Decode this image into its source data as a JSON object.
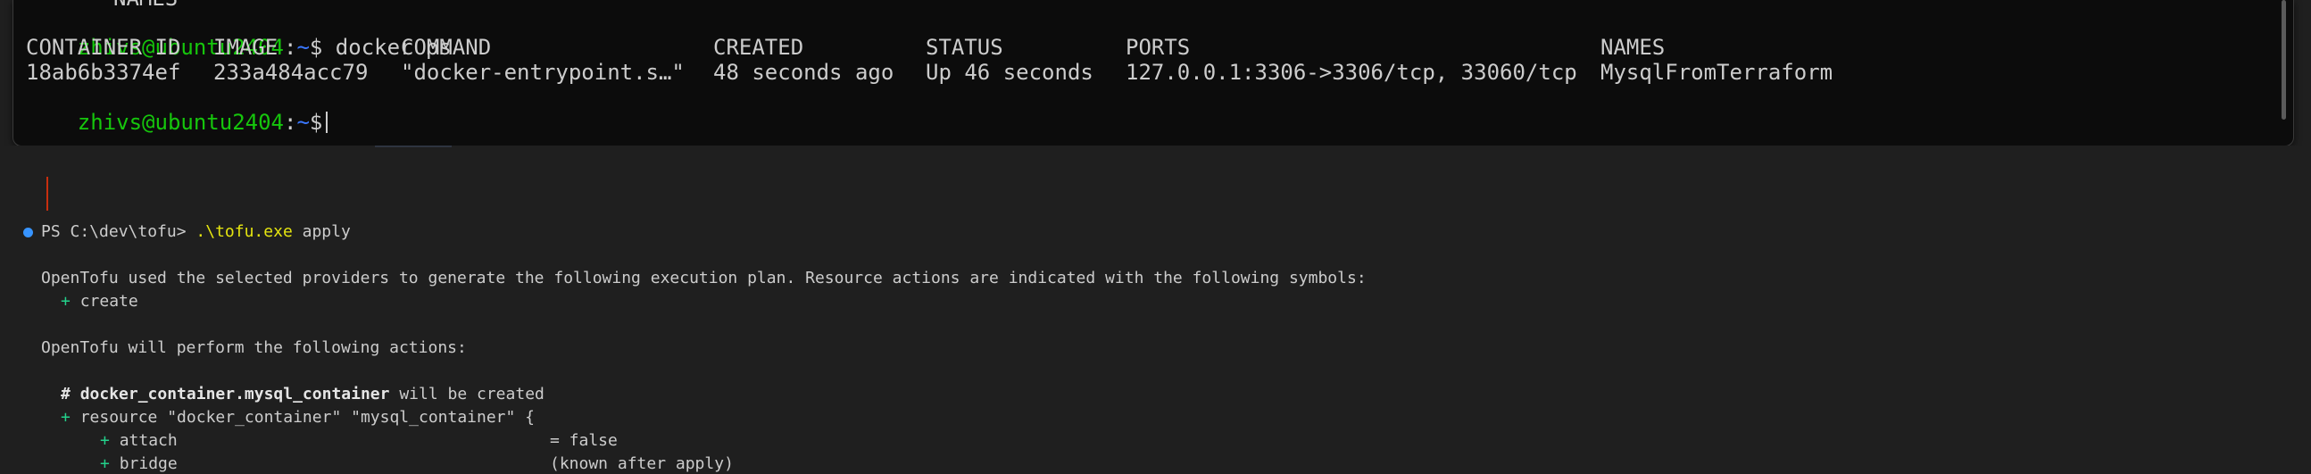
{
  "top_terminal": {
    "partial_line": "NAMES",
    "prompt_user_host": "zhivs@ubuntu2404",
    "prompt_colon": ":",
    "prompt_path": "~",
    "prompt_symbol": "$",
    "command": "docker ps",
    "columns": [
      "CONTAINER ID",
      "IMAGE",
      "COMMAND",
      "CREATED",
      "STATUS",
      "PORTS",
      "NAMES"
    ],
    "row": [
      "18ab6b3374ef",
      "233a484acc79",
      "\"docker-entrypoint.s…\"",
      "48 seconds ago",
      "Up 46 seconds",
      "127.0.0.1:3306->3306/tcp, 33060/tcp",
      "MysqlFromTerraform"
    ]
  },
  "bottom_terminal": {
    "prompt": "PS C:\\dev\\tofu>",
    "exe": ".\\tofu.exe",
    "arg": "apply",
    "plan_intro": "OpenTofu used the selected providers to generate the following execution plan. Resource actions are indicated with the following symbols:",
    "symbol_plus": "+",
    "symbol_create": "create",
    "will_perform": "OpenTofu will perform the following actions:",
    "hash": "#",
    "resource_address": "docker_container.mysql_container",
    "will_be_created": "will be created",
    "resource_line": "resource \"docker_container\" \"mysql_container\" {",
    "attr_name": "attach",
    "attr_value": "= false",
    "next_attr_name": "bridge",
    "next_attr_value": "(known after apply)"
  },
  "colors": {
    "terminal_bg": "#0c0c0c",
    "panel_bg": "#1f1f1f",
    "prompt_green": "#16c60c",
    "path_blue": "#3b78ff",
    "exe_yellow": "#e5e510",
    "plus_green": "#23d18b",
    "status_dot": "#3794ff"
  }
}
